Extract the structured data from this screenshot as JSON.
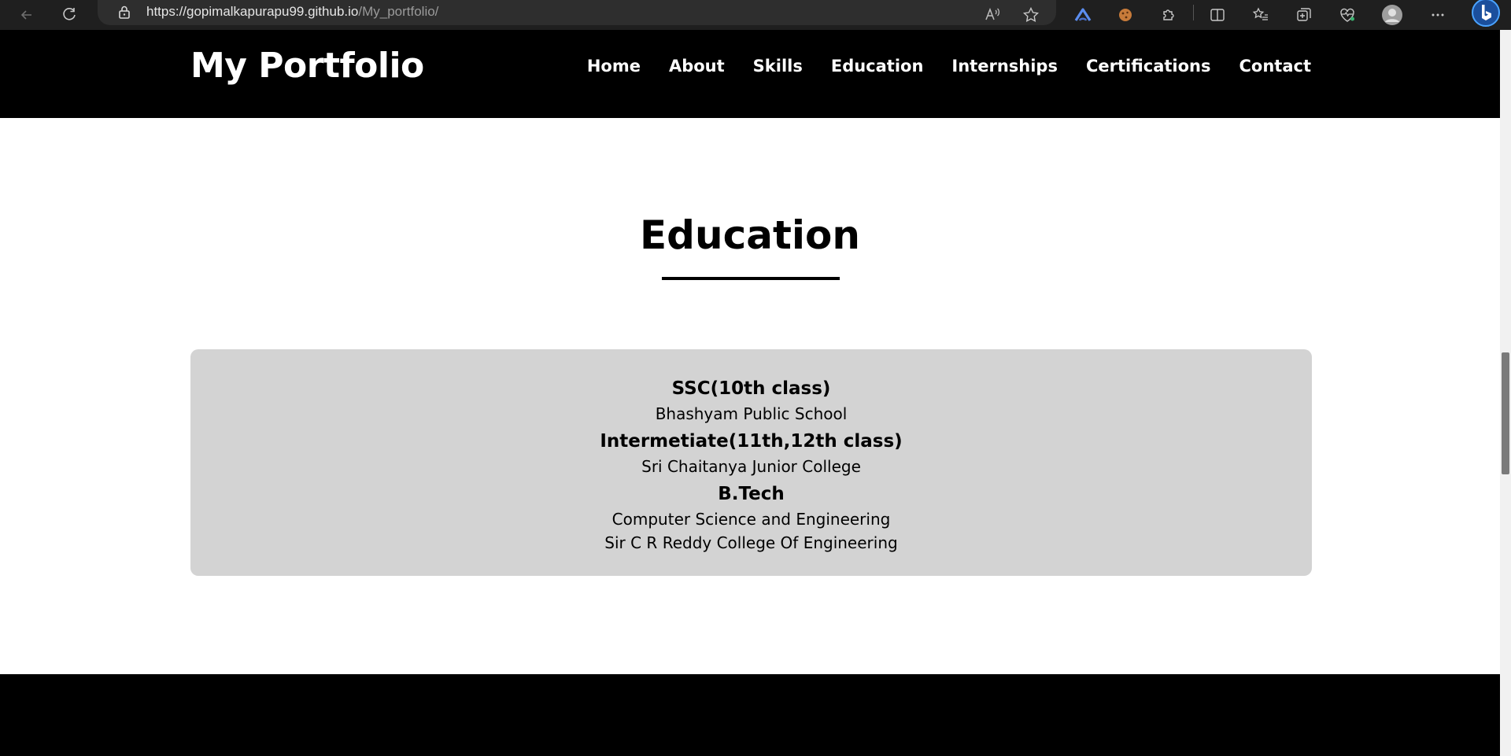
{
  "browser": {
    "url_host": "https://gopimalkapurapu99.github.io",
    "url_path": "/My_portfolio/"
  },
  "site": {
    "brand": "My Portfolio",
    "nav": [
      "Home",
      "About",
      "Skills",
      "Education",
      "Internships",
      "Certifications",
      "Contact"
    ]
  },
  "education": {
    "title": "Education",
    "entries": [
      {
        "title": "SSC(10th class)",
        "details": [
          "Bhashyam Public School"
        ]
      },
      {
        "title": "Intermetiate(11th,12th class)",
        "details": [
          "Sri Chaitanya Junior College"
        ]
      },
      {
        "title": "B.Tech",
        "details": [
          "Computer Science and Engineering",
          "Sir C R Reddy College Of Engineering"
        ]
      }
    ]
  },
  "colors": {
    "header_bg": "#000000",
    "card_bg": "#d3d3d3",
    "chrome_bg": "#1f1f1f"
  }
}
